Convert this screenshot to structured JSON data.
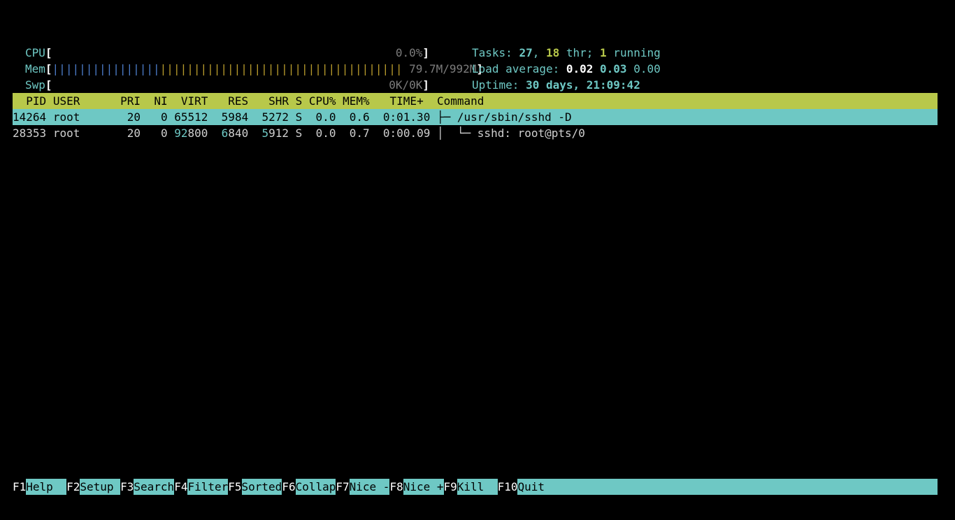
{
  "meters": {
    "cpu": {
      "label": "CPU",
      "value": "0.0%",
      "fraction": 0.0
    },
    "mem": {
      "label": "Mem",
      "value": "79.7M/992M",
      "bar_blue": "||||||||||||||||",
      "bar_yellow": "||||||||||||||||||||||||||||||||||||"
    },
    "swp": {
      "label": "Swp",
      "value": "0K/0K",
      "fraction": 0.0
    }
  },
  "info": {
    "tasks_label": "Tasks: ",
    "tasks": "27",
    "sep1": ", ",
    "threads": "18",
    "thr_label": " thr; ",
    "running": "1",
    "running_label": " running",
    "load_label": "Load average: ",
    "load1": "0.02",
    "load5": "0.03",
    "load15": "0.00",
    "uptime_label": "Uptime: ",
    "uptime": "30 days, 21:09:42"
  },
  "table": {
    "columns": [
      "PID",
      "USER",
      "PRI",
      "NI",
      "VIRT",
      "RES",
      "SHR",
      "S",
      "CPU%",
      "MEM%",
      "TIME+",
      "Command"
    ],
    "rows": [
      {
        "pid": "14264",
        "user": "root",
        "pri": "20",
        "ni": "0",
        "virt": "65512",
        "res": "5984",
        "shr": "5272",
        "s": "S",
        "cpu": "0.0",
        "mem": "0.6",
        "time": "0:01.30",
        "tree": "├─ ",
        "command": "/usr/sbin/sshd -D",
        "selected": true
      },
      {
        "pid": "28353",
        "user": "root",
        "pri": "20",
        "ni": "0",
        "virt_hi": "92",
        "virt_lo": "800",
        "res_hi": "6",
        "res_lo": "840",
        "shr_hi": "5",
        "shr_lo": "912",
        "s": "S",
        "cpu": "0.0",
        "mem": "0.7",
        "time": "0:00.09",
        "tree": "│  └─ ",
        "command": "sshd: root@pts/0",
        "selected": false
      }
    ]
  },
  "function_bar": [
    {
      "key": "F1",
      "label": "Help  "
    },
    {
      "key": "F2",
      "label": "Setup "
    },
    {
      "key": "F3",
      "label": "Search"
    },
    {
      "key": "F4",
      "label": "Filter"
    },
    {
      "key": "F5",
      "label": "Sorted"
    },
    {
      "key": "F6",
      "label": "Collap"
    },
    {
      "key": "F7",
      "label": "Nice -"
    },
    {
      "key": "F8",
      "label": "Nice +"
    },
    {
      "key": "F9",
      "label": "Kill  "
    },
    {
      "key": "F10",
      "label": "Quit"
    }
  ],
  "colors": {
    "background": "#000000",
    "cyan": "#6ec8c4",
    "green_header": "#b8c84a",
    "bar_blue": "#4b7bc8",
    "bar_yellow": "#b69a2c"
  }
}
